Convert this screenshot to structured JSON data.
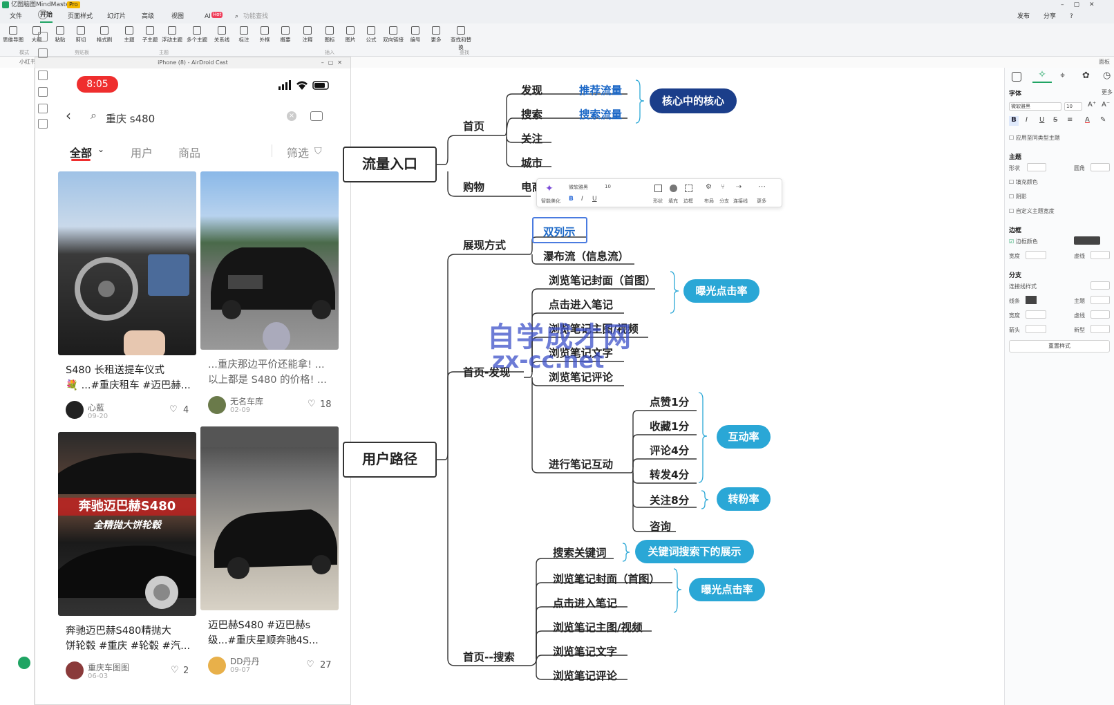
{
  "app": {
    "title": "亿图脑图MindMaster",
    "badge": "Pro",
    "menu": [
      "文件",
      "开始",
      "页面样式",
      "幻灯片",
      "高级",
      "视图",
      "AI"
    ],
    "ai_badge": "Hot",
    "search_placeholder": "功能查找",
    "top_right": [
      "发布",
      "分享"
    ],
    "ribbon": [
      "思维导图",
      "大纲",
      "粘贴",
      "剪切",
      "格式刷",
      "主题",
      "子主题",
      "浮动主题",
      "多个主题",
      "关系线",
      "标注",
      "外框",
      "概要",
      "注释",
      "图标",
      "图片",
      "公式",
      "双向链接",
      "编号",
      "更多",
      "查找和替换"
    ],
    "ribbon_groups": [
      "模式",
      "剪贴板",
      "主题",
      "插入",
      "查找"
    ],
    "subbar_tab": "小红书",
    "subbar_right": "面板"
  },
  "phone": {
    "window_title": "iPhone (8) - AirDroid Cast",
    "time": "8:05",
    "search_query": "重庆 s480",
    "tabs": [
      "全部",
      "用户",
      "商品"
    ],
    "filter": "筛选",
    "cards": [
      {
        "title": "S480 长租送提车仪式",
        "title2": "💐 ...#重庆租车 #迈巴赫...",
        "user": "心藍",
        "date": "09-20",
        "likes": "4"
      },
      {
        "title": "...重庆那边平价还能拿! ...",
        "title2": "以上都是 S480 的价格! ...",
        "user": "无名车库",
        "date": "02-09",
        "likes": "18"
      },
      {
        "title": "奔驰迈巴赫S480精抛大",
        "title2": "饼轮毂 #重庆 #轮毂 #汽...",
        "user": "重庆车图图",
        "date": "06-03",
        "likes": "2",
        "overlay1": "奔驰迈巴赫S480",
        "overlay2": "全精抛大饼轮毂"
      },
      {
        "title": "迈巴赫S480 #迈巴赫s",
        "title2": "级...#重庆星顺奔驰4S...",
        "user": "DD丹丹",
        "date": "09-07",
        "likes": "27"
      }
    ]
  },
  "mindmap": {
    "root1": "流量入口",
    "root2": "用户路径",
    "n_shouye": "首页",
    "n_faxian": "发现",
    "n_tuijian": "推荐流量",
    "n_sousuo": "搜索",
    "n_sousuoliuliang": "搜索流量",
    "n_guanzhu": "关注",
    "n_chengshi": "城市",
    "n_gouwu": "购物",
    "n_dian": "电商",
    "pill_core": "核心中的核心",
    "n_zhanxian": "展现方式",
    "n_shuanglie": "双列示",
    "n_pubuliu": "瀑布流（信息流）",
    "n_shouyefaxian": "首页-发现",
    "n_fengmian1": "浏览笔记封面（首图）",
    "n_dianji1": "点击进入笔记",
    "n_zhutu1": "浏览笔记主图/视频",
    "n_wenzi1": "浏览笔记文字",
    "n_pinglun1": "浏览笔记评论",
    "pill_exposure1": "曝光点击率",
    "n_hudong": "进行笔记互动",
    "n_dianzan": "点赞1分",
    "n_shoucang": "收藏1分",
    "n_pinglun4": "评论4分",
    "n_zhuanfa": "转发4分",
    "n_guanzhu8": "关注8分",
    "n_zixun": "咨询",
    "pill_hudong": "互动率",
    "pill_zhuanfen": "转粉率",
    "n_shouyesousuo": "首页--搜索",
    "n_guanjianci": "搜索关键词",
    "pill_keyword": "关键词搜索下的展示",
    "n_fengmian2": "浏览笔记封面（首图）",
    "n_dianji2": "点击进入笔记",
    "n_zhutu2": "浏览笔记主图/视频",
    "n_wenzi2": "浏览笔记文字",
    "n_pinglun2": "浏览笔记评论",
    "pill_exposure2": "曝光点击率",
    "watermark1": "自学成才网",
    "watermark2": "zx-cc.net"
  },
  "float_toolbar": {
    "font": "微软雅黑",
    "size": "10",
    "labels": [
      "智能美化",
      "形状",
      "填充",
      "边框",
      "布局",
      "分支",
      "连接线",
      "更多"
    ]
  },
  "right_panel": {
    "font_section": "字体",
    "font_more": "更多",
    "font_name": "微软雅黑",
    "font_size": "10",
    "apply_same": "应用至同类型主题",
    "topic_section": "主题",
    "shape": "形状",
    "rounded": "圆角",
    "fill_color": "填充颜色",
    "shadow": "阴影",
    "custom_width": "自定义主题宽度",
    "border_section": "边框",
    "border_color": "边框颜色",
    "width": "宽度",
    "dash": "虚线",
    "branch_section": "分支",
    "connector_style": "连接线样式",
    "line": "线条",
    "topic": "主题",
    "arrow": "箭头",
    "curve": "新型",
    "reset": "重置样式"
  },
  "colors": {
    "accent": "#2aa7d6",
    "dark_pill": "#1b3e8a",
    "phone_red": "#ef2e2e",
    "link_blue": "#1c68c7"
  }
}
